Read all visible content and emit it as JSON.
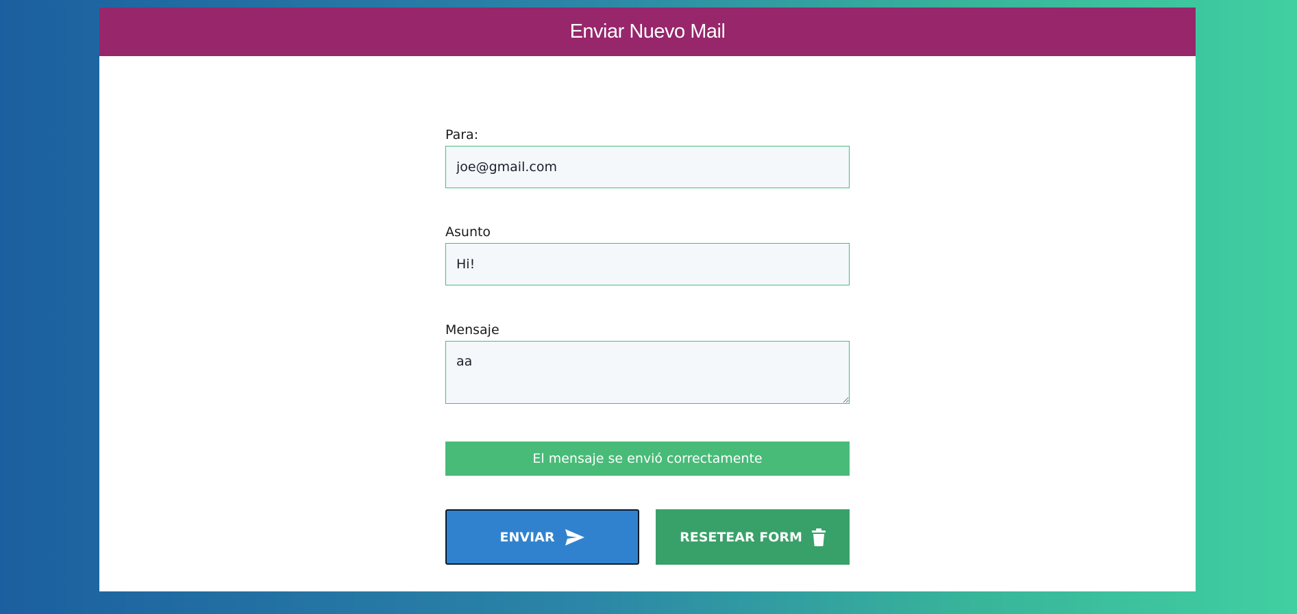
{
  "header": {
    "title": "Enviar Nuevo Mail"
  },
  "form": {
    "to": {
      "label": "Para:",
      "value": "joe@gmail.com"
    },
    "subject": {
      "label": "Asunto",
      "value": "Hi!"
    },
    "message": {
      "label": "Mensaje",
      "value": "aa"
    },
    "success_message": "El mensaje se envió correctamente",
    "send_button": {
      "label": "ENVIAR",
      "icon": "send-icon"
    },
    "reset_button": {
      "label": "RESETEAR FORM",
      "icon": "trash-icon"
    }
  },
  "colors": {
    "header_bg": "#97266b",
    "input_border": "#48bb78",
    "success_bg": "#48bb78",
    "send_bg": "#3182ce",
    "reset_bg": "#38a169"
  }
}
